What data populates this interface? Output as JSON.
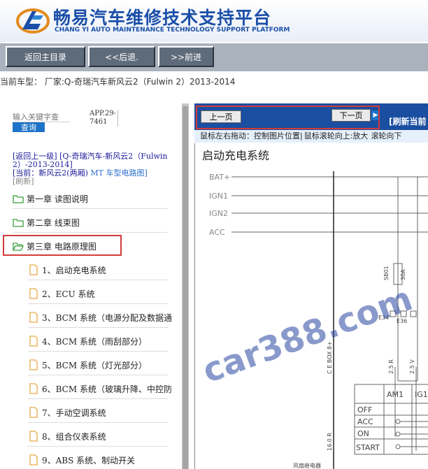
{
  "header": {
    "title": "畅易汽车维修技术支持平台",
    "subtitle": "CHANG YI AUTO MAINTENANCE TECHNOLOGY SUPPORT PLATFORM"
  },
  "toolbar": {
    "home_label": "返回主目录",
    "back_label": "<<后退.",
    "forward_label": ">>前进"
  },
  "vehicle_bar": "当前车型： 厂家:Q-奇瑞汽车新风云2（Fulwin 2）2013-2014",
  "left": {
    "search_placeholder": "输入关键字查",
    "search_button": "查询",
    "app_id": "APP.29-7461",
    "nav": {
      "up": "[返回上一级]",
      "vehicle": "[Q-奇瑞汽车-新风云2（Fulwin 2）-2013-2014]",
      "current": "[当前：新风云2(两厢)",
      "current_suffix": "MT 车型电路图]",
      "refresh": "[刷新]"
    },
    "chapters": [
      {
        "label": "第一章 读图说明"
      },
      {
        "label": "第二章 线束图"
      },
      {
        "label": "第三章 电路原理图"
      }
    ],
    "items": [
      {
        "label": "1、启动充电系统"
      },
      {
        "label": "2、ECU 系统"
      },
      {
        "label": "3、BCM 系统（电源分配及数据通"
      },
      {
        "label": "4、BCM 系统（雨刮部分）"
      },
      {
        "label": "5、BCM 系统（灯光部分）"
      },
      {
        "label": "6、BCM 系统（玻璃升降、中控防"
      },
      {
        "label": "7、手动空调系统"
      },
      {
        "label": "8、组合仪表系统"
      },
      {
        "label": "9、ABS 系统、制动开关"
      }
    ]
  },
  "right": {
    "prev_label": "上一页",
    "next_label": "下一页",
    "refresh_label": "[刷新当前",
    "hint_drag": "鼠标左右拖动：控制图片位置",
    "hint_wheel_up": "鼠标滚轮向上:放大",
    "hint_wheel_down": "滚轮向下",
    "diagram": {
      "title": "启动充电系统",
      "rails": [
        "BAT+",
        "IGN1",
        "IGN2",
        "ACC"
      ],
      "fuse_label": "SB01",
      "fuse_rating": "30A",
      "connector_a": "E34",
      "connector_b": "E36",
      "box_label": "C E BOX 8+",
      "wire_a": "2.5 R",
      "wire_b": "2.5 V",
      "wire_c": "16.0 R",
      "switch_cols": [
        "AM1",
        "IG1"
      ],
      "switch_rows": [
        "OFF",
        "ACC",
        "ON",
        "START"
      ],
      "bottom_label": "风扇继电器"
    },
    "watermark": "car388.com"
  },
  "colors": {
    "brand_blue": "#1b4fa8",
    "toolbar_gray": "#a9b2bd",
    "button_dark": "#5e6b7a",
    "panel_blue": "#1a4ea0",
    "highlight_red": "#d23b3b",
    "folder_green": "#3a9c3a",
    "page_orange": "#e9a94a"
  },
  "icons": {
    "logo": "cy-logo-icon",
    "chapter": "folder-icon",
    "item": "document-icon",
    "next_arrow": "arrow-right-icon"
  }
}
